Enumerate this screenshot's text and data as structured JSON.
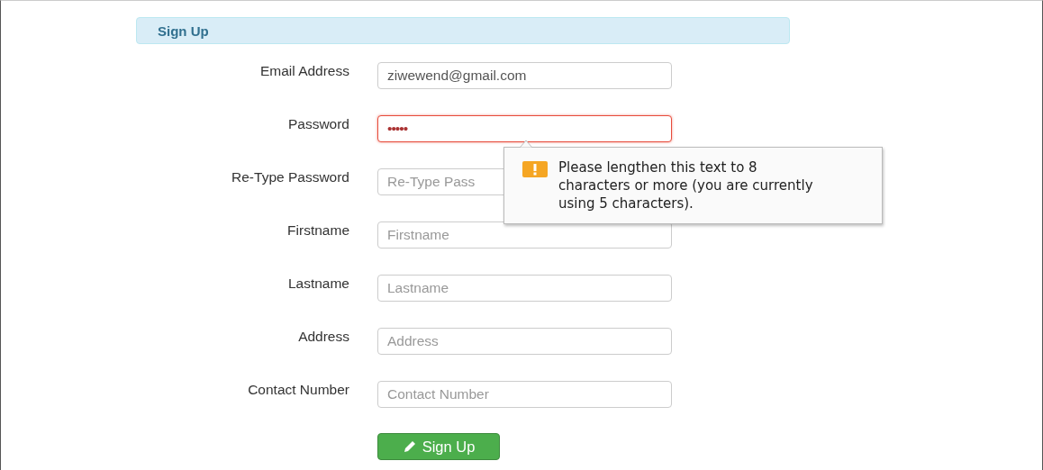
{
  "panel": {
    "title": "Sign Up"
  },
  "fields": [
    {
      "label": "Email Address",
      "value": "ziwewend@gmail.com",
      "invalid": false
    },
    {
      "label": "Password",
      "value": "•••••",
      "invalid": true,
      "tooltip": "Please lengthen this text to 8 characters or more (you are currently using 5 characters)."
    },
    {
      "label": "Re-Type Password",
      "placeholder": "Re-Type Pass",
      "invalid": false
    },
    {
      "label": "Firstname",
      "placeholder": "Firstname",
      "invalid": false
    },
    {
      "label": "Lastname",
      "placeholder": "Lastname",
      "invalid": false
    },
    {
      "label": "Address",
      "placeholder": "Address",
      "invalid": false
    },
    {
      "label": "Contact Number",
      "placeholder": "Contact Number",
      "invalid": false
    }
  ],
  "submit": {
    "label": "Sign Up"
  }
}
